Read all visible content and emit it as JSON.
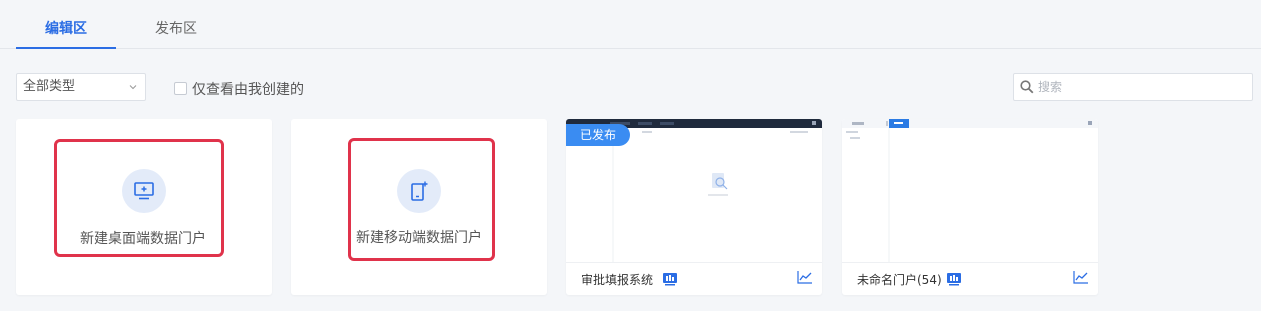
{
  "tabs": [
    {
      "label": "编辑区",
      "active": true
    },
    {
      "label": "发布区",
      "active": false
    }
  ],
  "filter": {
    "type_select": "全部类型",
    "only_mine_label": "仅查看由我创建的",
    "search_placeholder": "搜索"
  },
  "new_cards": [
    {
      "label": "新建桌面端数据门户"
    },
    {
      "label": "新建移动端数据门户"
    }
  ],
  "portals": [
    {
      "title": "审批填报系统",
      "status_badge": "已发布"
    },
    {
      "title": "未命名门户(54)"
    }
  ],
  "colors": {
    "accent": "#2b6de4",
    "highlight_border": "#e0334b",
    "published_badge": "#3a8cf2"
  }
}
